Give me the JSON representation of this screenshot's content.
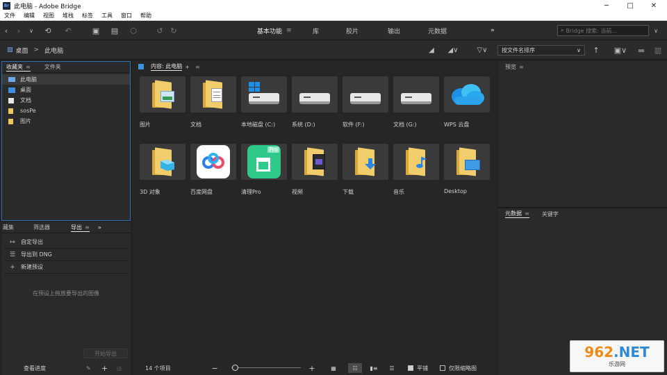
{
  "window": {
    "app_icon": "Br",
    "title": "此电脑 - Adobe Bridge",
    "minimize_icon": "minimize-icon",
    "maximize_icon": "maximize-icon",
    "close_icon": "close-icon"
  },
  "menu": [
    "文件",
    "编辑",
    "视图",
    "堆栈",
    "标签",
    "工具",
    "窗口",
    "帮助"
  ],
  "workspaces": {
    "items": [
      "基本功能",
      "库",
      "胶片",
      "输出",
      "元数据"
    ],
    "active": "基本功能",
    "more": "»"
  },
  "search": {
    "placeholder": "Bridge 搜索: 当前..."
  },
  "path": {
    "root": "桌面",
    "separator": ">",
    "current": "此电脑"
  },
  "sort": {
    "label": "按文件名排序"
  },
  "favorites_panel": {
    "tabs": [
      "收藏夹",
      "文件夹"
    ],
    "items": [
      {
        "label": "此电脑",
        "icon": "computer-icon",
        "selected": true
      },
      {
        "label": "桌面",
        "icon": "desktop-icon",
        "selected": false
      },
      {
        "label": "文档",
        "icon": "document-icon",
        "selected": false
      },
      {
        "label": "sosPe",
        "icon": "folder-icon",
        "selected": false
      },
      {
        "label": "图片",
        "icon": "image-icon",
        "selected": false
      }
    ]
  },
  "export_panel": {
    "tabs": [
      "藏集",
      "筛选器",
      "导出"
    ],
    "active_tab": "导出",
    "items": [
      {
        "label": "自定导出",
        "icon": "export-icon"
      },
      {
        "label": "导出到 DNG",
        "icon": "list-icon"
      },
      {
        "label": "新建预设",
        "icon": "plus-icon"
      }
    ],
    "drop_hint": "在预设上拖放要导出的图像",
    "start_button": "开始导出",
    "queue_label": "查看进度"
  },
  "content_panel": {
    "header": "内容: 此电脑",
    "items": [
      {
        "label": "图片",
        "type": "folder-pictures"
      },
      {
        "label": "文档",
        "type": "folder-documents"
      },
      {
        "label": "本地磁盘 (C:)",
        "type": "drive-windows"
      },
      {
        "label": "系统 (D:)",
        "type": "drive"
      },
      {
        "label": "软件 (F:)",
        "type": "drive"
      },
      {
        "label": "文档 (G:)",
        "type": "drive"
      },
      {
        "label": "WPS 云盘",
        "type": "cloud"
      },
      {
        "label": "3D 对象",
        "type": "folder-3d"
      },
      {
        "label": "百度网盘",
        "type": "app-baidu"
      },
      {
        "label": "清理Pro",
        "type": "app-clean"
      },
      {
        "label": "视频",
        "type": "folder-video"
      },
      {
        "label": "下载",
        "type": "folder-download"
      },
      {
        "label": "音乐",
        "type": "folder-music"
      },
      {
        "label": "Desktop",
        "type": "folder-desktop"
      }
    ],
    "status": {
      "count": "14 个项目",
      "thumbnail_zoom": 0.05,
      "flat_view_label": "平铺",
      "flat_view_checked": true,
      "thumbnails_only_label": "仅限缩略图",
      "thumbnails_only_checked": false
    }
  },
  "preview_panel": {
    "tab": "预览"
  },
  "metadata_panel": {
    "tabs": [
      "元数据",
      "关键字"
    ]
  },
  "watermark": {
    "num": "962",
    "net": ".NET",
    "sub": "乐游网"
  }
}
